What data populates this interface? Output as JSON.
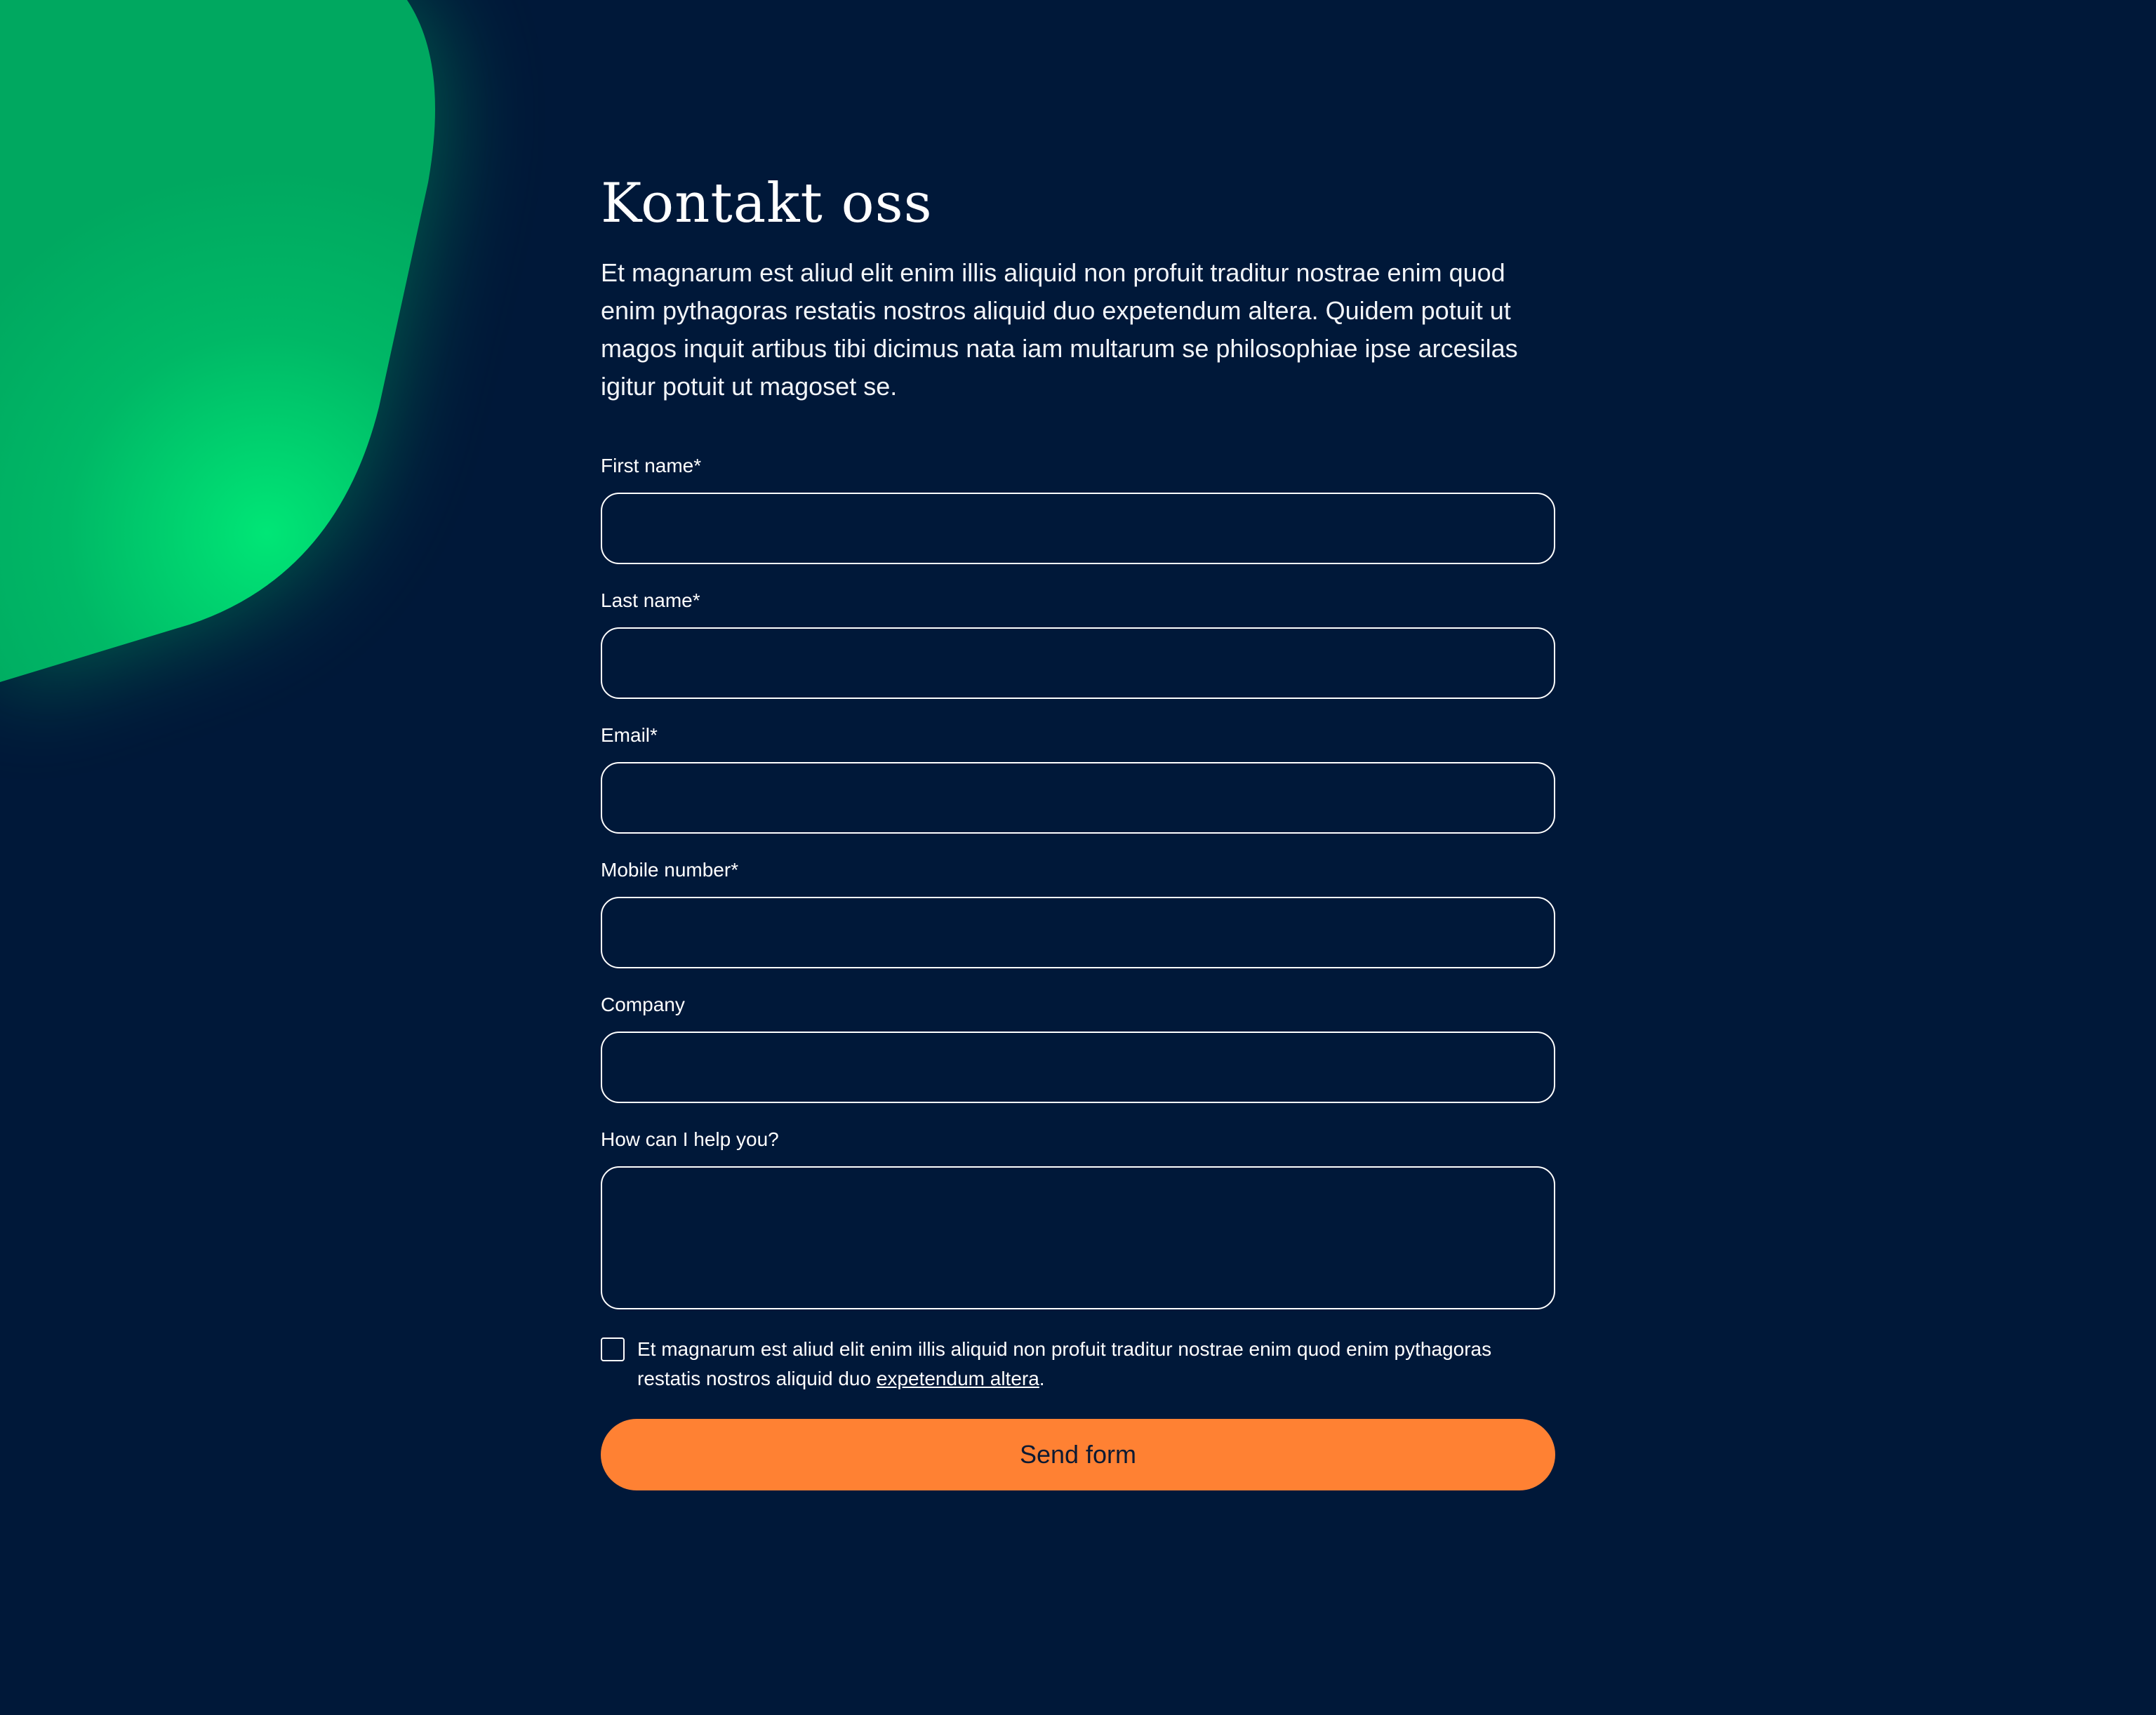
{
  "colors": {
    "background": "#001839",
    "accent_green": "#00d26a",
    "button_orange": "#ff8133",
    "button_text": "#0c1a33",
    "text": "#ffffff"
  },
  "header": {
    "title": "Kontakt oss",
    "intro": "Et magnarum est aliud elit enim illis aliquid non profuit traditur nostrae enim quod enim pythagoras restatis nostros aliquid duo expetendum altera. Quidem potuit ut magos inquit artibus tibi dicimus nata iam multarum se philosophiae ipse arcesilas igitur potuit ut magoset se."
  },
  "form": {
    "fields": {
      "first_name": {
        "label": "First name*",
        "value": ""
      },
      "last_name": {
        "label": "Last name*",
        "value": ""
      },
      "email": {
        "label": "Email*",
        "value": ""
      },
      "mobile": {
        "label": "Mobile number*",
        "value": ""
      },
      "company": {
        "label": "Company",
        "value": ""
      },
      "message": {
        "label": "How can I help you?",
        "value": ""
      }
    },
    "consent": {
      "checked": false,
      "text_before": "Et magnarum est aliud elit enim illis aliquid non profuit traditur nostrae enim quod enim pythagoras restatis nostros aliquid duo ",
      "link_text": "expetendum altera",
      "text_after": "."
    },
    "submit_label": "Send form"
  }
}
